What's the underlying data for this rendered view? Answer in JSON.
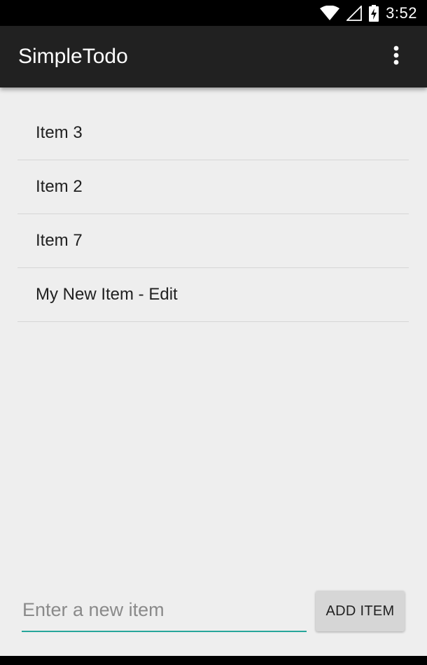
{
  "status_bar": {
    "time": "3:52",
    "icons": [
      "wifi-icon",
      "cell-signal-icon",
      "battery-charging-icon"
    ]
  },
  "app_bar": {
    "title": "SimpleTodo",
    "overflow_icon": "more-vert-icon"
  },
  "todo_list": {
    "items": [
      {
        "label": "Item 3"
      },
      {
        "label": "Item 2"
      },
      {
        "label": "Item 7"
      },
      {
        "label": "My New Item - Edit"
      }
    ]
  },
  "composer": {
    "input_value": "",
    "input_placeholder": "Enter a new item",
    "add_button_label": "ADD ITEM"
  },
  "colors": {
    "app_bar": "#212121",
    "background": "#eeeeee",
    "accent": "#26a69a",
    "button": "#d6d6d6"
  }
}
